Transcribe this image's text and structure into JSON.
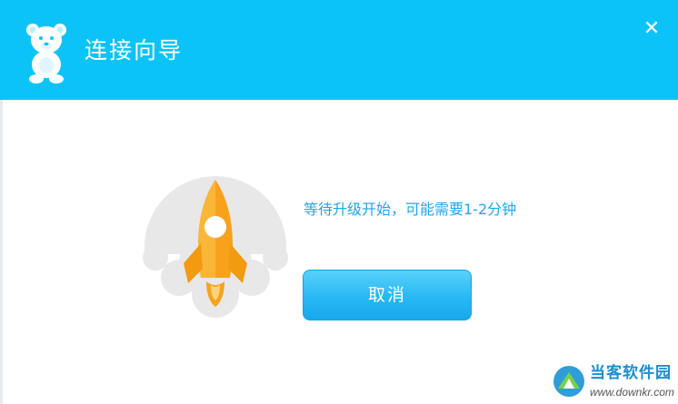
{
  "window": {
    "title": "连接向导",
    "close_symbol": "✕"
  },
  "icons": {
    "logo": "bear-logo-icon",
    "close": "close-icon",
    "rocket": "rocket-icon"
  },
  "main": {
    "status_text": "等待升级开始，可能需要1-2分钟",
    "cancel_label": "取消"
  },
  "watermark": {
    "name": "当客软件园",
    "url": "www.downkr.com"
  },
  "colors": {
    "header": "#0cc3f7",
    "accent_text": "#20a6e8",
    "rocket_body": "#f7a21d",
    "cloud": "#e8e8e8"
  }
}
